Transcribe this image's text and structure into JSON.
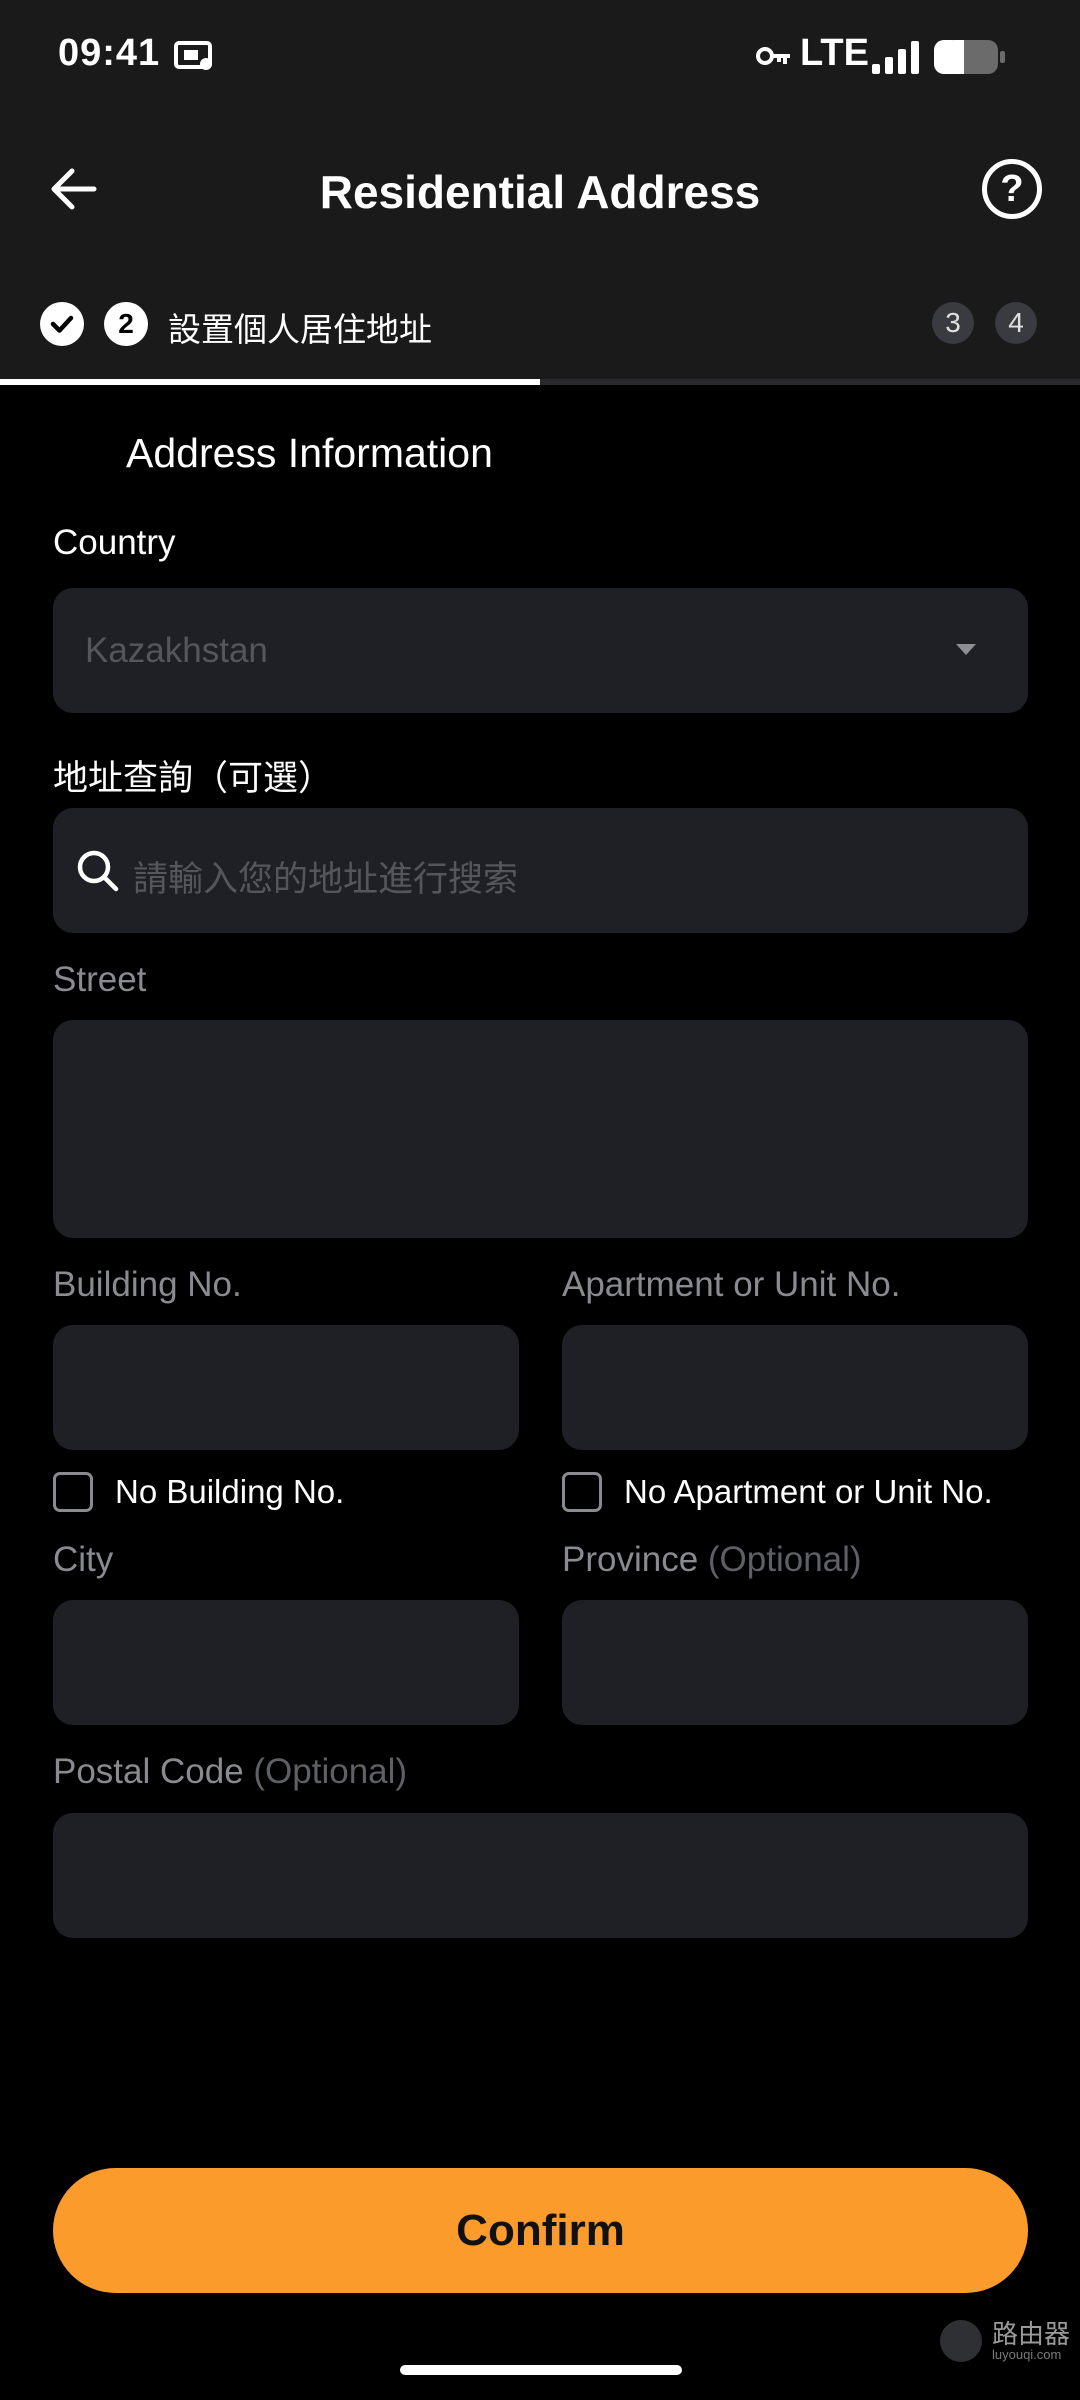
{
  "status_bar": {
    "time": "09:41",
    "network": "LTE",
    "battery_level": 0.4
  },
  "header": {
    "title": "Residential Address",
    "help_label": "?"
  },
  "stepper": {
    "current_step": "2",
    "current_label": "設置個人居住地址",
    "upcoming": [
      "3",
      "4"
    ],
    "progress": 0.5
  },
  "form": {
    "section_title": "Address Information",
    "country": {
      "label": "Country",
      "value": "Kazakhstan"
    },
    "address_search": {
      "label": "地址查詢（可選）",
      "placeholder": "請輸入您的地址進行搜索"
    },
    "street": {
      "label": "Street",
      "value": ""
    },
    "building": {
      "label": "Building No.",
      "value": "",
      "checkbox_label": "No Building No.",
      "checked": false
    },
    "apartment": {
      "label": "Apartment or Unit No.",
      "value": "",
      "checkbox_label": "No Apartment or Unit No.",
      "checked": false
    },
    "city": {
      "label": "City",
      "value": ""
    },
    "province": {
      "label": "Province",
      "optional": "(Optional)",
      "value": ""
    },
    "postal_code": {
      "label": "Postal Code",
      "optional": "(Optional)",
      "value": ""
    }
  },
  "confirm_label": "Confirm",
  "watermark": {
    "main": "路由器",
    "sub": "luyouqi.com"
  },
  "colors": {
    "accent": "#fb9b2c",
    "background": "#000000",
    "field": "#1f2025",
    "chrome": "#1a1a1a"
  }
}
